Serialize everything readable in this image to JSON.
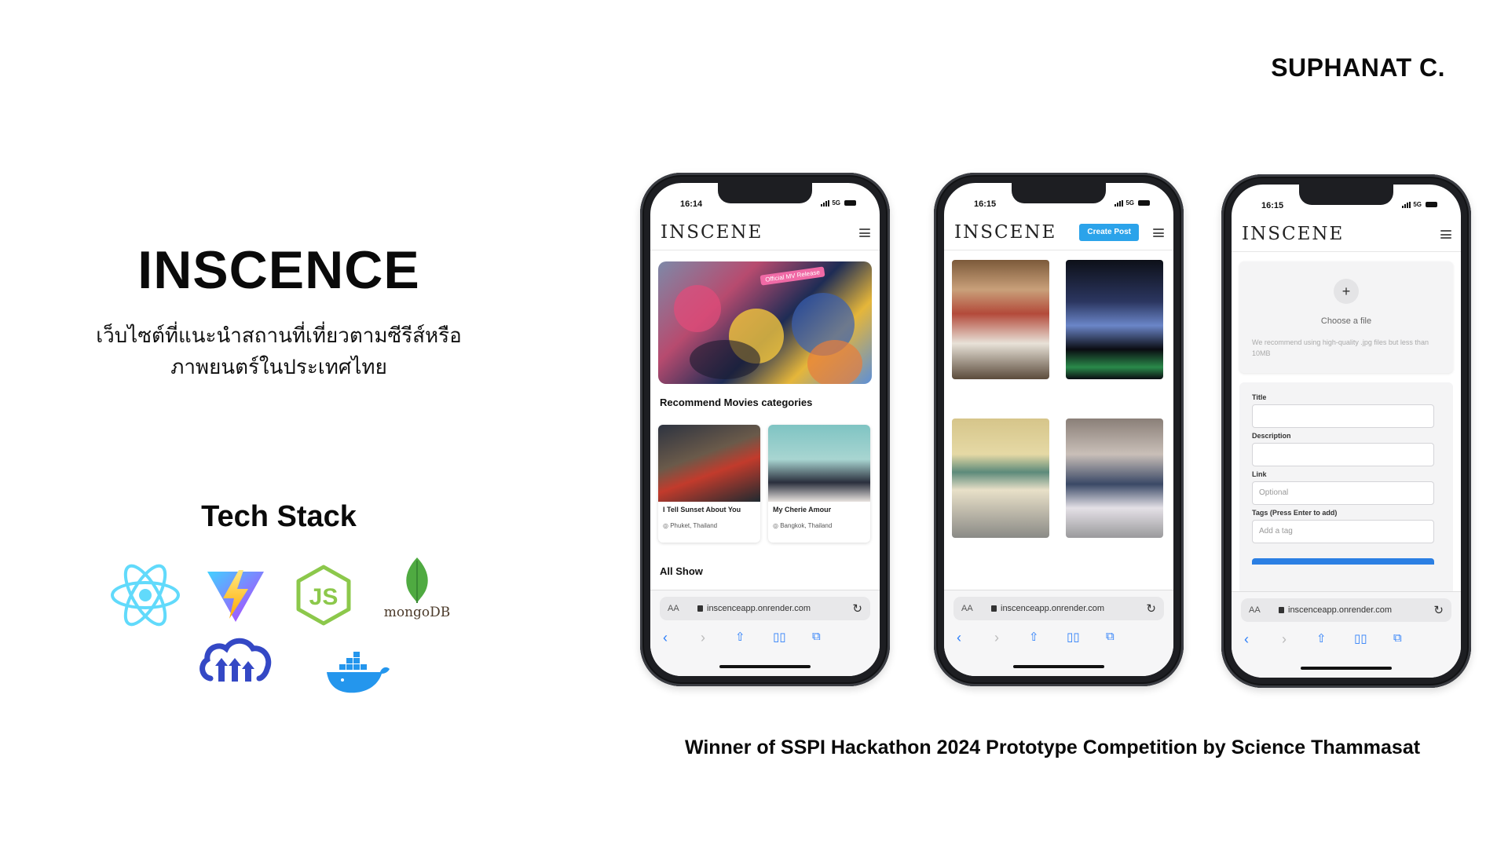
{
  "author": "SUPHANAT C.",
  "project": {
    "title": "INSCENCE",
    "description_line1": "เว็บไซต์ที่แนะนำสถานที่เที่ยวตามซีรีส์หรือ",
    "description_line2": "ภาพยนตร์ในประเทศไทย"
  },
  "tech_stack": {
    "title": "Tech Stack",
    "logos": [
      "react-icon",
      "vite-icon",
      "nodejs-icon",
      "mongodb-icon",
      "cloudinary-icon",
      "docker-icon"
    ],
    "mongodb_wordmark": "mongoDB"
  },
  "award": "Winner of SSPI Hackathon 2024 Prototype Competition by Science Thammasat",
  "colors": {
    "accent": "#2ba3ea",
    "safari_blue": "#2d7ff9",
    "react": "#61dafb",
    "node": "#8cc84b",
    "mongo": "#4faa41",
    "cloudinary": "#3448c5",
    "docker": "#2496ed"
  },
  "browser": {
    "aa": "AA",
    "url": "inscenceapp.onrender.com"
  },
  "app": {
    "logo": "INSCENE",
    "create_post": "Create Post"
  },
  "phone1": {
    "time": "16:14",
    "network": "5G",
    "hero_sticker": "Official MV Release",
    "section_recommend": "Recommend Movies categories",
    "cards": [
      {
        "title": "I Tell Sunset About You",
        "location": "Phuket, Thailand"
      },
      {
        "title": "My Cherie Amour",
        "location": "Bangkok, Thailand"
      }
    ],
    "section_all": "All Show"
  },
  "phone2": {
    "time": "16:15",
    "network": "5G",
    "images": [
      "restaurant-photo",
      "night-bar-photo",
      "street-building-photo",
      "fashion-group-photo"
    ]
  },
  "phone3": {
    "time": "16:15",
    "network": "5G",
    "plus": "+",
    "choose_file": "Choose a file",
    "upload_hint": "We recommend using high-quality .jpg files but less than 10MB",
    "fields": [
      {
        "label": "Title",
        "placeholder": ""
      },
      {
        "label": "Description",
        "placeholder": ""
      },
      {
        "label": "Link",
        "placeholder": "Optional"
      },
      {
        "label": "Tags (Press Enter to add)",
        "placeholder": "Add a tag"
      }
    ]
  }
}
